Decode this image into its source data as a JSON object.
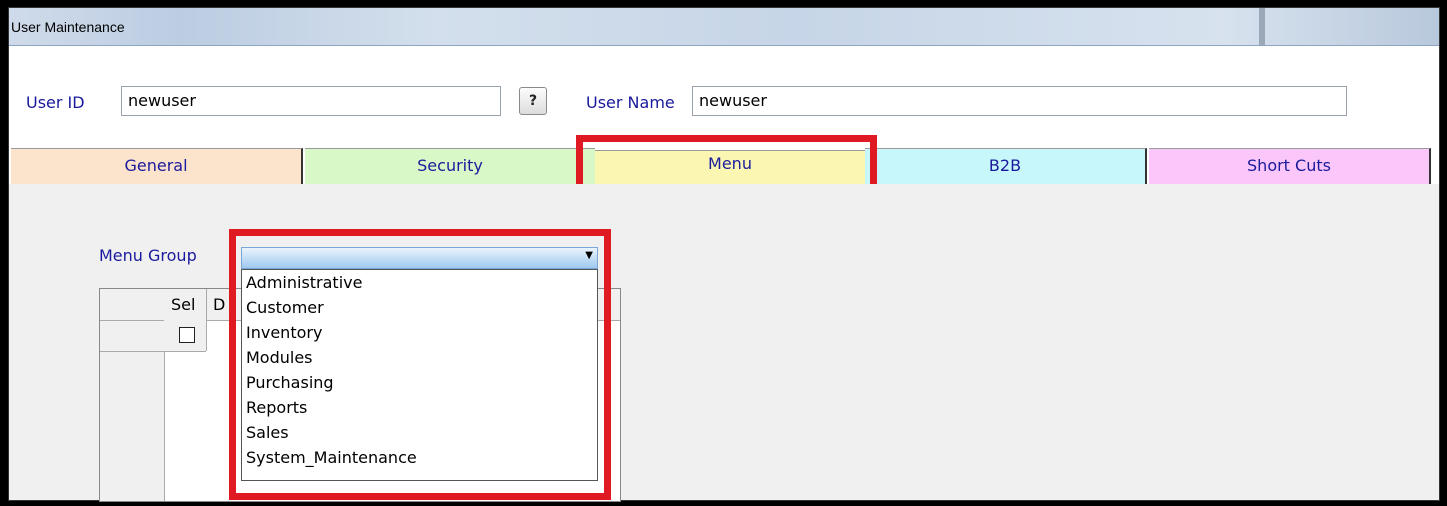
{
  "window": {
    "title": "User Maintenance"
  },
  "header": {
    "user_id_label": "User ID",
    "user_id_value": "newuser",
    "lookup_button": "?",
    "user_name_label": "User Name",
    "user_name_value": "newuser"
  },
  "tabs": [
    {
      "label": "General",
      "color": "#fbe3cc"
    },
    {
      "label": "Security",
      "color": "#d9f8c7"
    },
    {
      "label": "Menu",
      "color": "#fbf7b3"
    },
    {
      "label": "B2B",
      "color": "#c7f7fb"
    },
    {
      "label": "Short Cuts",
      "color": "#fbc7fb"
    }
  ],
  "menu_group": {
    "label": "Menu Group",
    "selected": "",
    "options": [
      "Administrative",
      "Customer",
      "Inventory",
      "Modules",
      "Purchasing",
      "Reports",
      "Sales",
      "System_Maintenance"
    ]
  },
  "grid": {
    "columns": [
      "Sel",
      "D"
    ]
  },
  "accent": {
    "highlight": "#e01a22",
    "label_color": "#1a1a9c"
  }
}
